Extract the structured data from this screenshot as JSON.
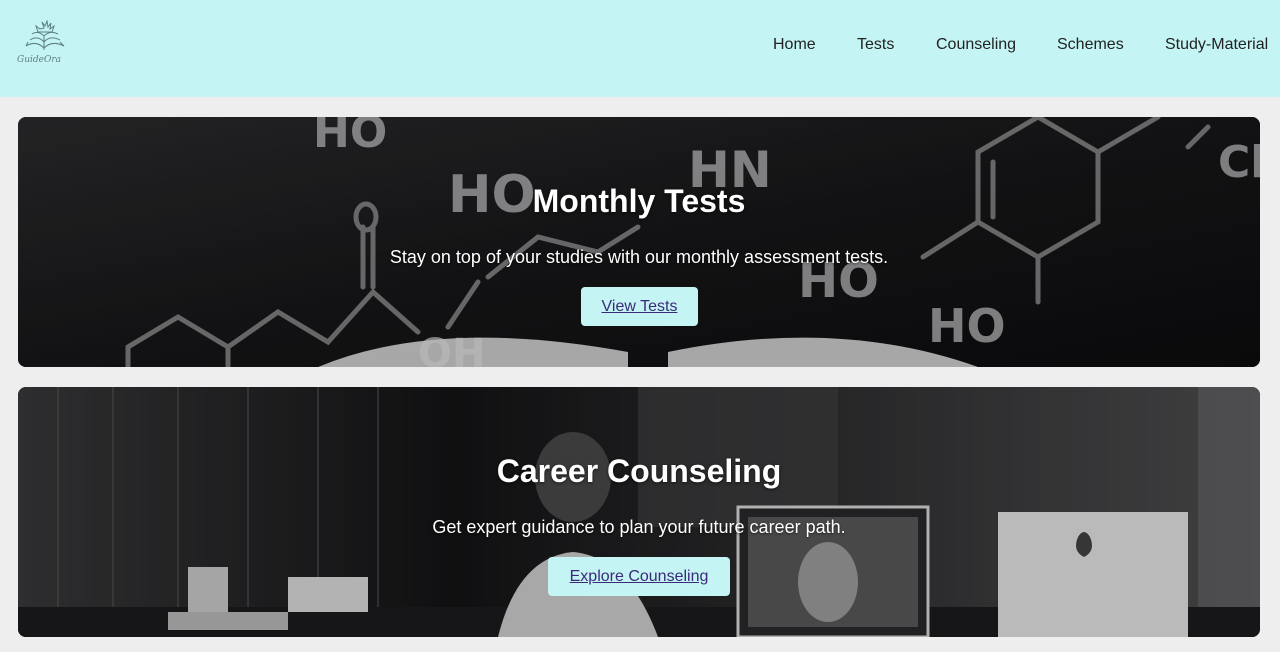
{
  "header": {
    "logo_icon": "open-book-lotus-logo",
    "logo_text": "GuideOra",
    "background_color": "#c4f5f4",
    "nav": {
      "home": "Home",
      "tests": "Tests",
      "counseling": "Counseling",
      "schemes": "Schemes",
      "study_material": "Study-Material"
    }
  },
  "cards": {
    "tests": {
      "title": "Monthly Tests",
      "description": "Stay on top of your studies with our monthly assessment tests.",
      "button_label": "View Tests",
      "background_icon": "chemistry-chalkboard-image"
    },
    "counseling": {
      "title": "Career Counseling",
      "description": "Get expert guidance to plan your future career path.",
      "button_label": "Explore Counseling",
      "background_icon": "office-desk-computers-image"
    }
  },
  "colors": {
    "accent": "#c4f5f4",
    "button_text": "#3b2a7a",
    "page_background": "#eeeeee"
  }
}
